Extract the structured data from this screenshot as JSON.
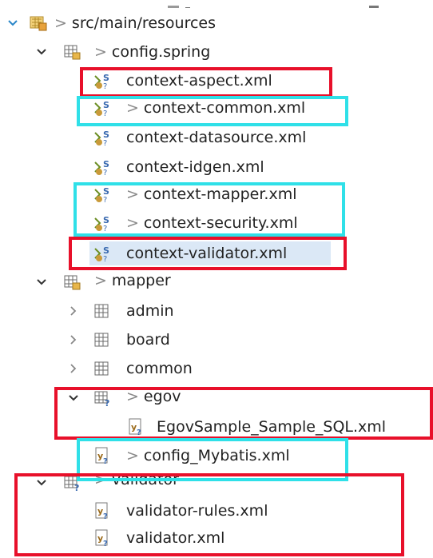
{
  "tree": {
    "root_label": "src/main/resources",
    "items": [
      {
        "label": "context-aspect.xml",
        "dirty": false
      },
      {
        "label": "context-common.xml",
        "dirty": true
      },
      {
        "label": "context-datasource.xml",
        "dirty": false
      },
      {
        "label": "context-idgen.xml",
        "dirty": false
      },
      {
        "label": "context-mapper.xml",
        "dirty": true
      },
      {
        "label": "context-security.xml",
        "dirty": true
      },
      {
        "label": "context-validator.xml",
        "dirty": false
      }
    ],
    "config_spring_label": "config.spring",
    "mapper_label": "mapper",
    "admin_label": "admin",
    "board_label": "board",
    "common_label": "common",
    "egov_label": "egov",
    "egov_sql_label": "EgovSample_Sample_SQL.xml",
    "config_mybatis_label": "config_Mybatis.xml",
    "validator_label": "validator",
    "validator_rules_label": "validator-rules.xml",
    "validator_xml_label": "validator.xml",
    "dirty_marker": ">"
  },
  "highlight_colors": {
    "red": "#e8102a",
    "cyan": "#2fe0e8",
    "selection": "#dbe8f6"
  }
}
